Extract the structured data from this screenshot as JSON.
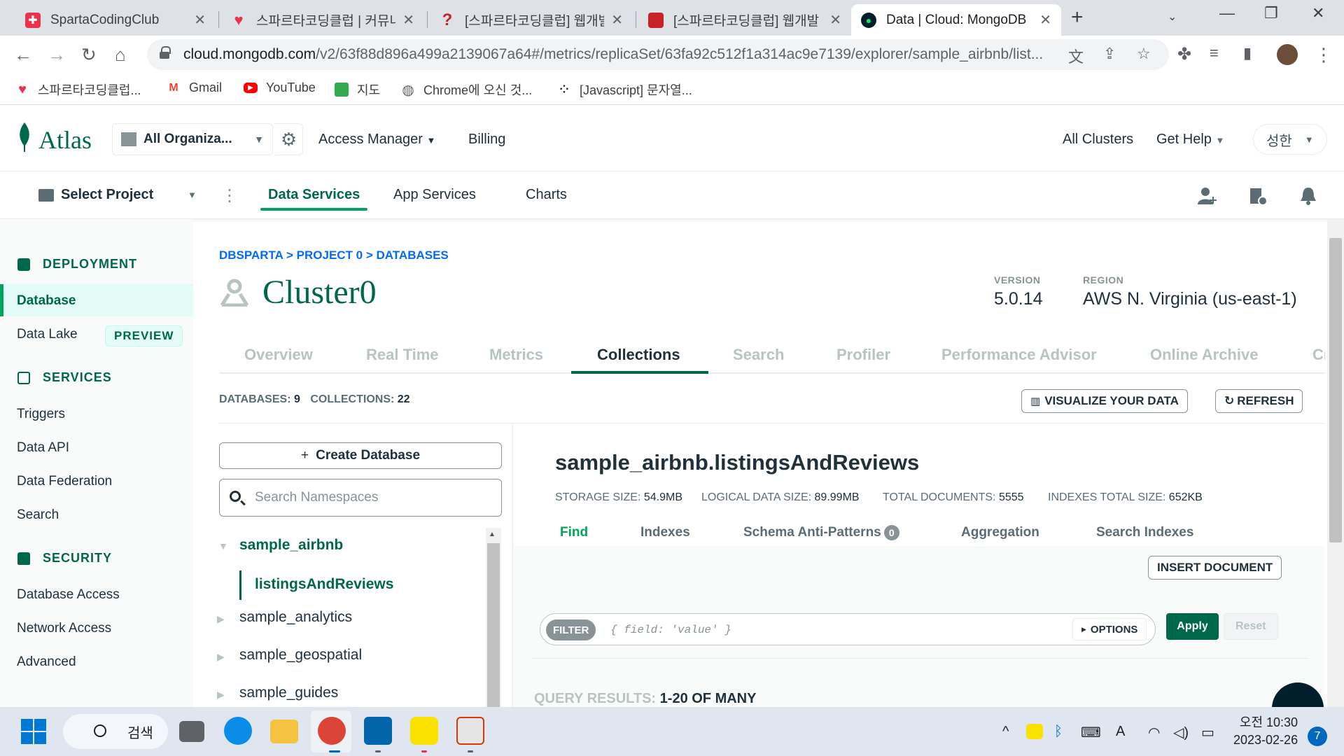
{
  "browser": {
    "tabs": [
      {
        "title": "SpartaCodingClub",
        "favicon_color": "#e8344e"
      },
      {
        "title": "스파르타코딩클럽 | 커뮤니",
        "favicon_color": "#e8344e"
      },
      {
        "title": "[스파르타코딩클럽] 웹개발",
        "favicon_color": "#e8344e"
      },
      {
        "title": "[스파르타코딩클럽] 웹개발",
        "favicon_color": "#c7222a"
      },
      {
        "title": "Data | Cloud: MongoDB",
        "favicon_color": "#00684a"
      }
    ],
    "close_glyph": "✕",
    "new_tab_glyph": "+",
    "url_host": "cloud.mongodb.com",
    "url_path": "/v2/63f88d896a499a2139067a64#/metrics/replicaSet/63fa92c512f1a314ac9e7139/explorer/sample_airbnb/list...",
    "bookmarks": [
      {
        "label": "스파르타코딩클럽...",
        "icon": "sparta-heart-icon"
      },
      {
        "label": "Gmail",
        "icon": "gmail-icon"
      },
      {
        "label": "YouTube",
        "icon": "youtube-icon"
      },
      {
        "label": "지도",
        "icon": "maps-icon"
      },
      {
        "label": "Chrome에 오신 것...",
        "icon": "globe-icon"
      },
      {
        "label": "[Javascript] 문자열...",
        "icon": "dots-icon"
      }
    ]
  },
  "atlas": {
    "logo": "Atlas",
    "org": "All Organiza...",
    "access_manager": "Access Manager",
    "billing": "Billing",
    "all_clusters": "All Clusters",
    "get_help": "Get Help",
    "user": "성한",
    "project": "Select Project",
    "project_tabs": [
      "Data Services",
      "App Services",
      "Charts"
    ]
  },
  "sidebar": {
    "deployment": "DEPLOYMENT",
    "database": "Database",
    "data_lake": "Data Lake",
    "preview": "PREVIEW",
    "services": "SERVICES",
    "triggers": "Triggers",
    "data_api": "Data API",
    "data_federation": "Data Federation",
    "search": "Search",
    "security": "SECURITY",
    "database_access": "Database Access",
    "network_access": "Network Access",
    "advanced": "Advanced"
  },
  "main": {
    "breadcrumb": "DBSPARTA > PROJECT 0 > DATABASES",
    "cluster_name": "Cluster0",
    "version_label": "VERSION",
    "version_value": "5.0.14",
    "region_label": "REGION",
    "region_value": "AWS N. Virginia (us-east-1)",
    "tabs": [
      "Overview",
      "Real Time",
      "Metrics",
      "Collections",
      "Search",
      "Profiler",
      "Performance Advisor",
      "Online Archive",
      "Cmd Line Tools"
    ],
    "active_tab": "Collections",
    "databases_label": "DATABASES:",
    "databases_count": "9",
    "collections_label": "COLLECTIONS:",
    "collections_count": "22",
    "visualize_btn": "VISUALIZE YOUR DATA",
    "refresh_btn": "REFRESH",
    "create_db_btn": "Create Database",
    "search_placeholder": "Search Namespaces",
    "databases": [
      "sample_airbnb",
      "sample_analytics",
      "sample_geospatial",
      "sample_guides"
    ],
    "active_collection": "listingsAndReviews",
    "collection_title": "sample_airbnb.listingsAndReviews",
    "stats": [
      {
        "label": "STORAGE SIZE:",
        "value": "54.9MB"
      },
      {
        "label": "LOGICAL DATA SIZE:",
        "value": "89.99MB"
      },
      {
        "label": "TOTAL DOCUMENTS:",
        "value": "5555"
      },
      {
        "label": "INDEXES TOTAL SIZE:",
        "value": "652KB"
      }
    ],
    "find_tabs": [
      "Find",
      "Indexes",
      "Schema Anti-Patterns",
      "Aggregation",
      "Search Indexes"
    ],
    "anti_patterns_count": "0",
    "insert_btn": "INSERT DOCUMENT",
    "filter_label": "FILTER",
    "filter_placeholder": "{ field: 'value' }",
    "options_btn": "OPTIONS",
    "apply_btn": "Apply",
    "reset_btn": "Reset",
    "query_results_label": "QUERY RESULTS:",
    "query_results_value": "1-20 OF MANY"
  },
  "taskbar": {
    "search_label": "검색",
    "clock_time": "오전 10:30",
    "clock_date": "2023-02-26",
    "notification_count": "7"
  }
}
